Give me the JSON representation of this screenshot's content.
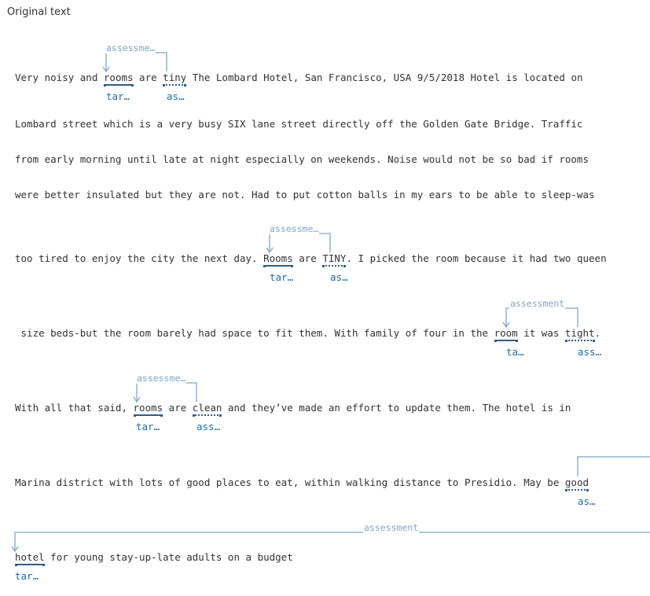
{
  "panel": {
    "heading": "Original text"
  },
  "lines": [
    [
      "Very noisy and ",
      {
        "t": "rooms",
        "k": "target"
      },
      " are ",
      {
        "t": "tiny",
        "k": "assess"
      },
      " The Lombard Hotel, San Francisco, USA 9/5/2018 Hotel is located on"
    ],
    [
      "Lombard street which is a very busy SIX lane street directly off the Golden Gate Bridge. Traffic"
    ],
    [
      "from early morning until late at night especially on weekends. Noise would not be so bad if rooms"
    ],
    [
      "were better insulated but they are not. Had to put cotton balls in my ears to be able to sleep-was"
    ],
    [
      "too tired to enjoy the city the next day. ",
      {
        "t": "Rooms",
        "k": "target"
      },
      " are ",
      {
        "t": "TINY",
        "k": "assess"
      },
      ". I picked the room because it had two queen"
    ],
    [
      " size beds-but the room barely had space to fit them. With family of four in the ",
      {
        "t": "room",
        "k": "target"
      },
      " it was ",
      {
        "t": "tight",
        "k": "assess"
      },
      "."
    ],
    [
      "With all that said, ",
      {
        "t": "rooms",
        "k": "target"
      },
      " are ",
      {
        "t": "clean",
        "k": "assess"
      },
      " and they’ve made an effort to update them. The hotel is in"
    ],
    [
      "Marina district with lots of good places to eat, within walking distance to Presidio. May be ",
      {
        "t": "good",
        "k": "assess"
      }
    ],
    [
      {
        "t": "hotel",
        "k": "target"
      },
      " for young stay-up-late adults on a budget"
    ]
  ],
  "tags": {
    "l0_target": "tar…",
    "l0_assess": "as…",
    "l4_target": "tar…",
    "l4_assess": "as…",
    "l5_target": "ta…",
    "l5_assess": "ass…",
    "l6_target": "tar…",
    "l6_assess": "ass…",
    "l7_assess": "as…",
    "l8_target": "tar…"
  },
  "arc_labels": {
    "a0": "assessme…",
    "a4": "assessme…",
    "a5": "assessment",
    "a6": "assessme…",
    "a8": "assessment"
  },
  "colors": {
    "target": "#2f5d89",
    "tag": "#1f6aa5",
    "arc": "#7fa6c9",
    "text": "#323130"
  }
}
